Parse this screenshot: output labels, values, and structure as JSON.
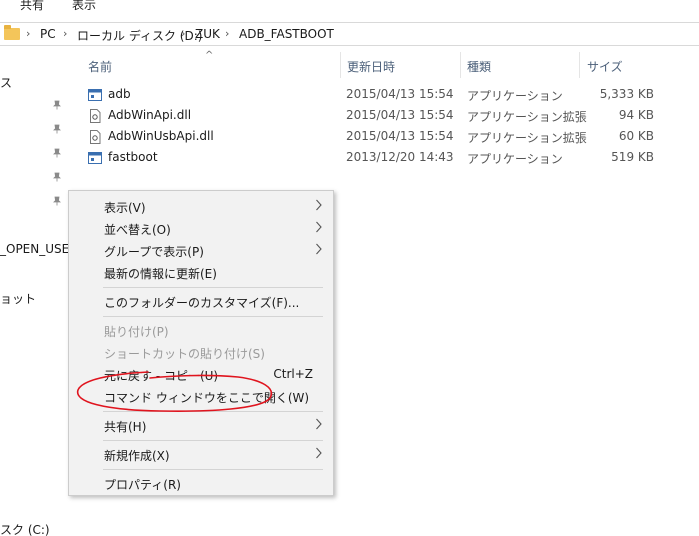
{
  "ribbon": {
    "tabs": [
      "共有",
      "表示"
    ]
  },
  "address": {
    "crumbs": [
      "PC",
      "ローカル ディスク (D:)",
      "ZUK",
      "ADB_FASTBOOT"
    ]
  },
  "navpane": {
    "items": [
      "ス",
      "_OPEN_USER",
      "ョット",
      "スク (C:)"
    ]
  },
  "columns": {
    "name": "名前",
    "date": "更新日時",
    "type": "種類",
    "size": "サイズ"
  },
  "files": [
    {
      "name": "adb",
      "date": "2015/04/13 15:54",
      "type": "アプリケーション",
      "size": "5,333 KB",
      "icon": "exe-icon"
    },
    {
      "name": "AdbWinApi.dll",
      "date": "2015/04/13 15:54",
      "type": "アプリケーション拡張",
      "size": "94 KB",
      "icon": "dll-icon"
    },
    {
      "name": "AdbWinUsbApi.dll",
      "date": "2015/04/13 15:54",
      "type": "アプリケーション拡張",
      "size": "60 KB",
      "icon": "dll-icon"
    },
    {
      "name": "fastboot",
      "date": "2013/12/20 14:43",
      "type": "アプリケーション",
      "size": "519 KB",
      "icon": "exe-icon"
    }
  ],
  "context_menu": {
    "view": "表示(V)",
    "sort": "並べ替え(O)",
    "group": "グループで表示(P)",
    "refresh": "最新の情報に更新(E)",
    "customize": "このフォルダーのカスタマイズ(F)...",
    "paste": "貼り付け(P)",
    "paste_shortcut": "ショートカットの貼り付け(S)",
    "undo": "元に戻す - コピー(U)",
    "undo_shortcut": "Ctrl+Z",
    "open_cmd": "コマンド ウィンドウをここで開く(W)",
    "share": "共有(H)",
    "new": "新規作成(X)",
    "properties": "プロパティ(R)"
  },
  "colors": {
    "annotation": "#e0141e",
    "menu_bg": "#f2f2f2",
    "header_text": "#4c607a"
  }
}
